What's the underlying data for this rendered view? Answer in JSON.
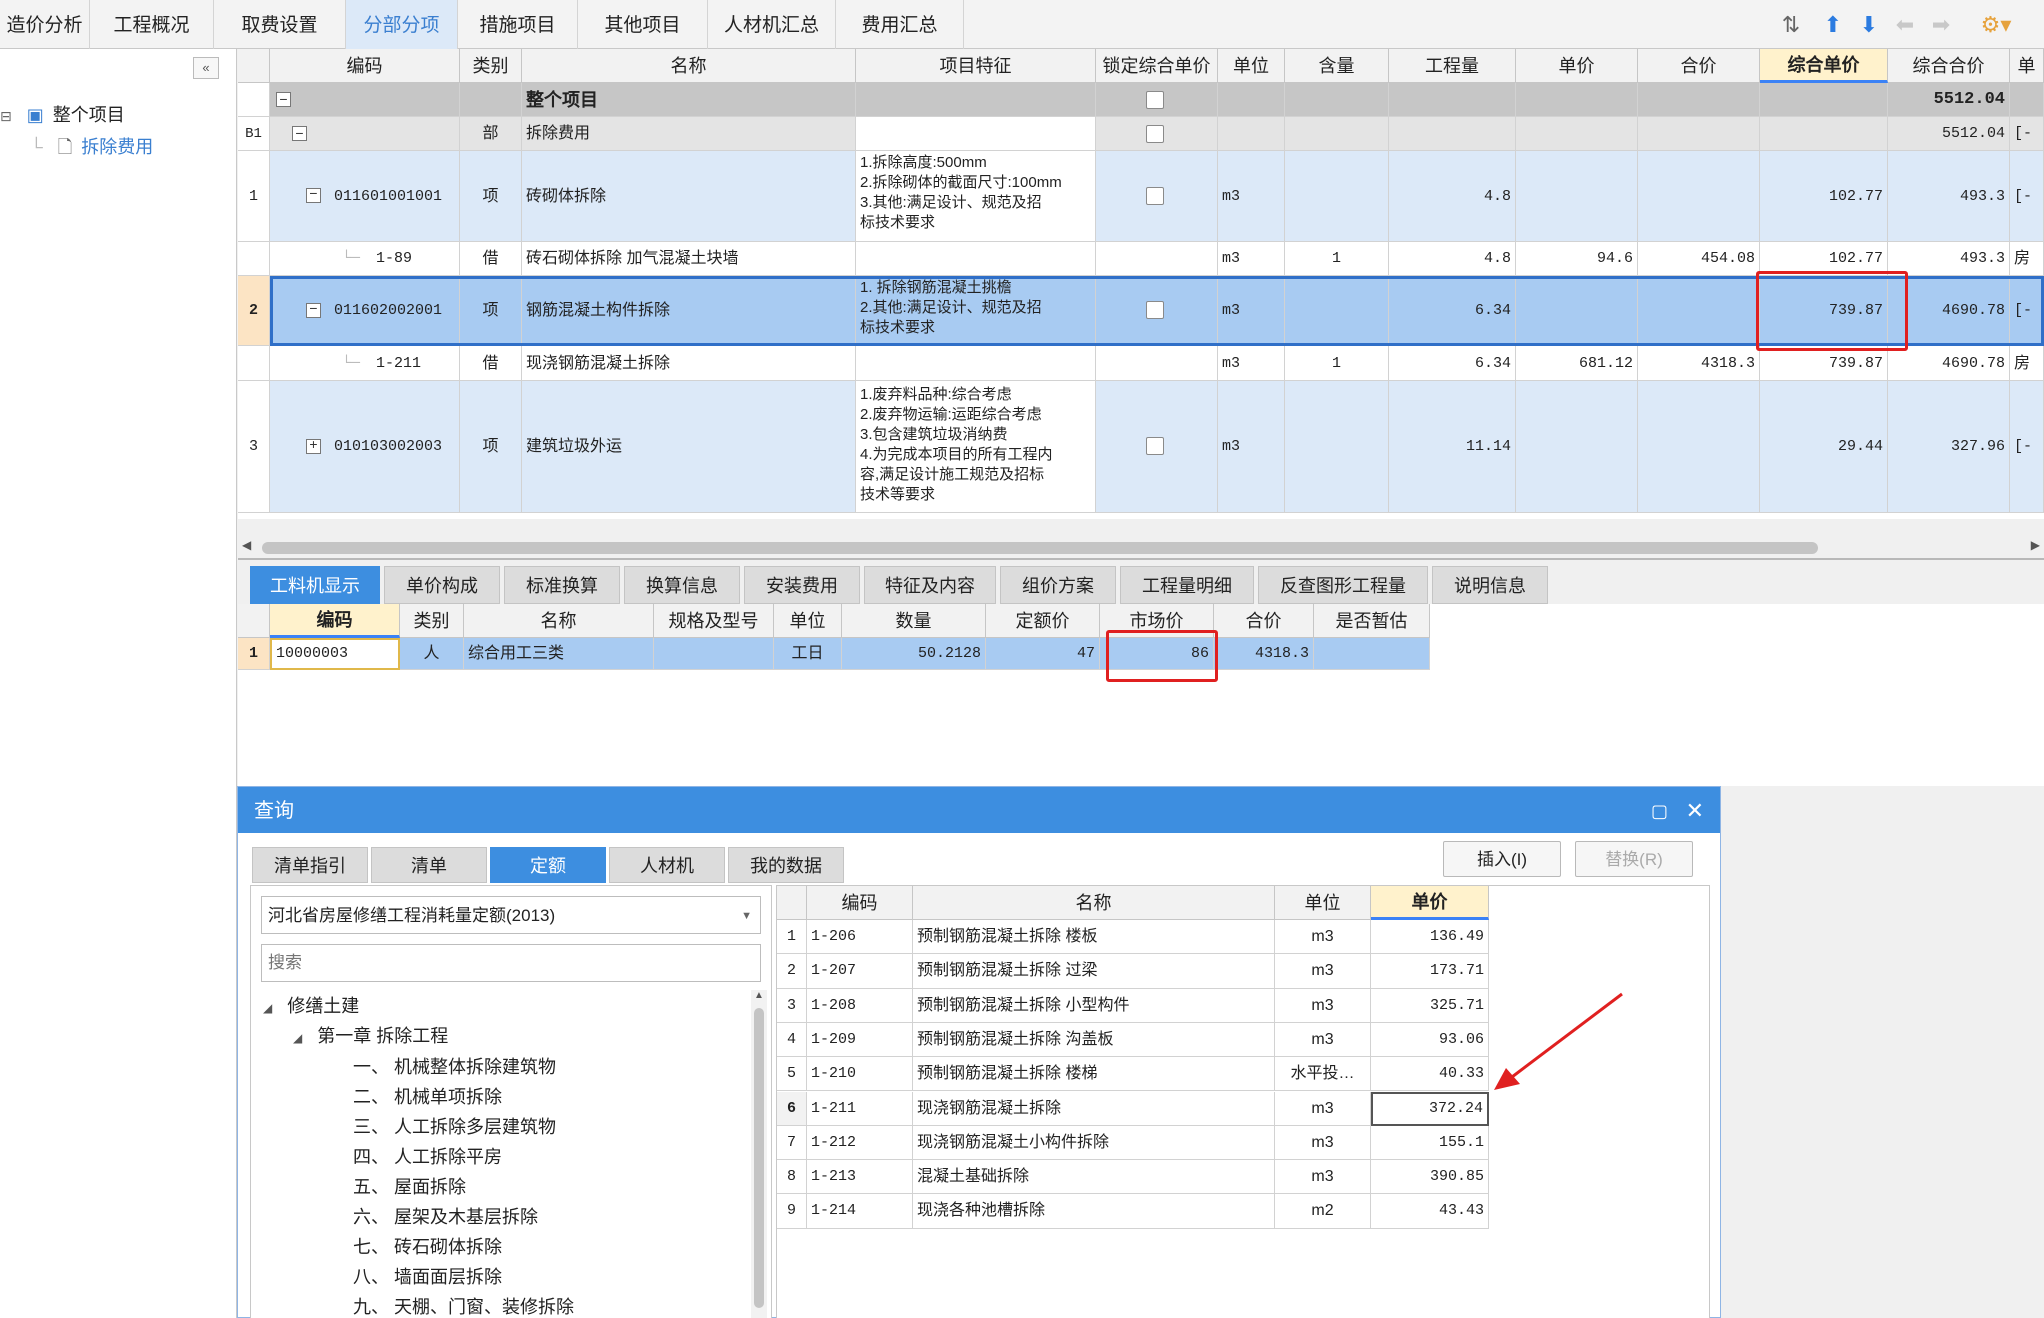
{
  "top_tabs": [
    "造价分析",
    "工程概况",
    "取费设置",
    "分部分项",
    "措施项目",
    "其他项目",
    "人材机汇总",
    "费用汇总"
  ],
  "active_top_tab": "分部分项",
  "toolbar_icons": [
    "sort-icon",
    "arrow-up-icon",
    "arrow-down-icon",
    "arrow-left-icon",
    "arrow-right-icon",
    "settings-icon"
  ],
  "tree": {
    "root": "整个项目",
    "child": "拆除费用"
  },
  "main_grid": {
    "columns": [
      "编码",
      "类别",
      "名称",
      "项目特征",
      "锁定综合单价",
      "单位",
      "含量",
      "工程量",
      "单价",
      "合价",
      "综合单价",
      "综合合价",
      "单"
    ],
    "rows": [
      {
        "seq": "",
        "code": "",
        "type": "",
        "name": "整个项目",
        "feature": [],
        "unit": "",
        "content": "",
        "qty": "",
        "price": "",
        "total": "",
        "comp_price": "",
        "comp_total": "5512.04",
        "extra": ""
      },
      {
        "seq": "B1",
        "code": "",
        "type": "部",
        "name": "拆除费用",
        "feature": [],
        "unit": "",
        "content": "",
        "qty": "",
        "price": "",
        "total": "",
        "comp_price": "",
        "comp_total": "5512.04",
        "extra": "[-"
      },
      {
        "seq": "1",
        "code": "011601001001",
        "type": "项",
        "name": "砖砌体拆除",
        "feature": [
          "1.拆除高度:500mm",
          "2.拆除砌体的截面尺寸:100mm",
          "3.其他:满足设计、规范及招",
          "标技术要求"
        ],
        "unit": "m3",
        "content": "",
        "qty": "4.8",
        "price": "",
        "total": "",
        "comp_price": "102.77",
        "comp_total": "493.3",
        "extra": "[-"
      },
      {
        "seq": "",
        "code": "1-89",
        "type": "借",
        "name": "砖石砌体拆除 加气混凝土块墙",
        "feature": [],
        "unit": "m3",
        "content": "1",
        "qty": "4.8",
        "price": "94.6",
        "total": "454.08",
        "comp_price": "102.77",
        "comp_total": "493.3",
        "extra": "房"
      },
      {
        "seq": "2",
        "code": "011602002001",
        "type": "项",
        "name": "钢筋混凝土构件拆除",
        "feature": [
          "1. 拆除钢筋混凝土挑檐",
          "2.其他:满足设计、规范及招",
          "标技术要求"
        ],
        "unit": "m3",
        "content": "",
        "qty": "6.34",
        "price": "",
        "total": "",
        "comp_price": "739.87",
        "comp_total": "4690.78",
        "extra": "[-"
      },
      {
        "seq": "",
        "code": "1-211",
        "type": "借",
        "name": "现浇钢筋混凝土拆除",
        "feature": [],
        "unit": "m3",
        "content": "1",
        "qty": "6.34",
        "price": "681.12",
        "total": "4318.3",
        "comp_price": "739.87",
        "comp_total": "4690.78",
        "extra": "房"
      },
      {
        "seq": "3",
        "code": "010103002003",
        "type": "项",
        "name": "建筑垃圾外运",
        "feature": [
          "1.废弃料品种:综合考虑",
          "2.废弃物运输:运距综合考虑",
          "3.包含建筑垃圾消纳费",
          "4.为完成本项目的所有工程内",
          "容,满足设计施工规范及招标",
          "技术等要求"
        ],
        "unit": "m3",
        "content": "",
        "qty": "11.14",
        "price": "",
        "total": "",
        "comp_price": "29.44",
        "comp_total": "327.96",
        "extra": "[-"
      }
    ]
  },
  "bottom_tabs": [
    "工料机显示",
    "单价构成",
    "标准换算",
    "换算信息",
    "安装费用",
    "特征及内容",
    "组价方案",
    "工程量明细",
    "反查图形工程量",
    "说明信息"
  ],
  "resource_grid": {
    "columns": [
      "编码",
      "类别",
      "名称",
      "规格及型号",
      "单位",
      "数量",
      "定额价",
      "市场价",
      "合价",
      "是否暂估"
    ],
    "rows": [
      {
        "seq": "1",
        "code": "10000003",
        "type": "人",
        "name": "综合用工三类",
        "spec": "",
        "unit": "工日",
        "qty": "50.2128",
        "quota_price": "47",
        "market_price": "86",
        "total": "4318.3",
        "provisional": ""
      }
    ]
  },
  "dialog": {
    "title": "查询",
    "tabs": [
      "清单指引",
      "清单",
      "定额",
      "人材机",
      "我的数据"
    ],
    "active_tab": "定额",
    "insert_btn": "插入(I)",
    "replace_btn": "替换(R)",
    "quota_select": "河北省房屋修缮工程消耗量定额(2013)",
    "search_placeholder": "搜索",
    "tree": {
      "l1": "修缮土建",
      "l2": "第一章 拆除工程",
      "items": [
        "一、 机械整体拆除建筑物",
        "二、 机械单项拆除",
        "三、 人工拆除多层建筑物",
        "四、 人工拆除平房",
        "五、 屋面拆除",
        "六、 屋架及木基层拆除",
        "七、 砖石砌体拆除",
        "八、 墙面面层拆除",
        "九、 天棚、门窗、装修拆除"
      ]
    },
    "grid": {
      "columns": [
        "编码",
        "名称",
        "单位",
        "单价"
      ],
      "rows": [
        {
          "seq": "1",
          "code": "1-206",
          "name": "预制钢筋混凝土拆除 楼板",
          "unit": "m3",
          "price": "136.49"
        },
        {
          "seq": "2",
          "code": "1-207",
          "name": "预制钢筋混凝土拆除 过梁",
          "unit": "m3",
          "price": "173.71"
        },
        {
          "seq": "3",
          "code": "1-208",
          "name": "预制钢筋混凝土拆除 小型构件",
          "unit": "m3",
          "price": "325.71"
        },
        {
          "seq": "4",
          "code": "1-209",
          "name": "预制钢筋混凝土拆除 沟盖板",
          "unit": "m3",
          "price": "93.06"
        },
        {
          "seq": "5",
          "code": "1-210",
          "name": "预制钢筋混凝土拆除 楼梯",
          "unit": "水平投…",
          "price": "40.33"
        },
        {
          "seq": "6",
          "code": "1-211",
          "name": "现浇钢筋混凝土拆除",
          "unit": "m3",
          "price": "372.24"
        },
        {
          "seq": "7",
          "code": "1-212",
          "name": "现浇钢筋混凝土小构件拆除",
          "unit": "m3",
          "price": "155.1"
        },
        {
          "seq": "8",
          "code": "1-213",
          "name": "混凝土基础拆除",
          "unit": "m3",
          "price": "390.85"
        },
        {
          "seq": "9",
          "code": "1-214",
          "name": "现浇各种池槽拆除",
          "unit": "m2",
          "price": "43.43"
        }
      ]
    }
  },
  "colors": {
    "accent": "#3d8ee0",
    "highlight": "#e02020",
    "row_blue": "#dce9f8",
    "row_selected": "#a8cbf2"
  }
}
